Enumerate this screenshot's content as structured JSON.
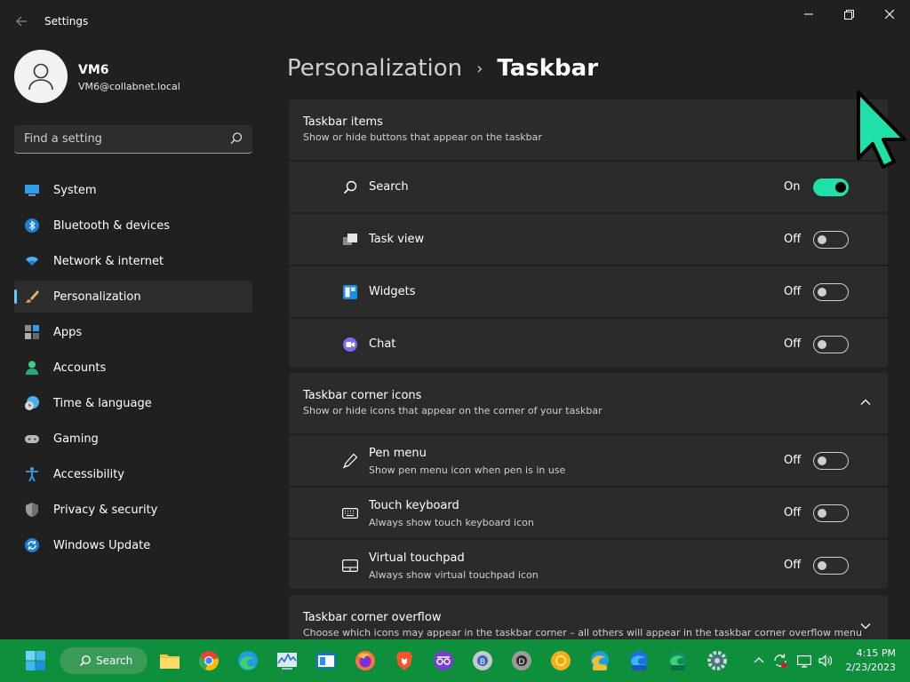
{
  "window": {
    "title": "Settings",
    "controls": {
      "minimize": "minimize-icon",
      "maximize": "restore-icon",
      "close": "close-icon"
    }
  },
  "profile": {
    "name": "VM6",
    "email": "VM6@collabnet.local"
  },
  "search": {
    "placeholder": "Find a setting"
  },
  "sidebar": {
    "items": [
      {
        "label": "System",
        "icon": "system-icon",
        "selected": false
      },
      {
        "label": "Bluetooth & devices",
        "icon": "bluetooth-icon",
        "selected": false
      },
      {
        "label": "Network & internet",
        "icon": "wifi-icon",
        "selected": false
      },
      {
        "label": "Personalization",
        "icon": "brush-icon",
        "selected": true
      },
      {
        "label": "Apps",
        "icon": "apps-icon",
        "selected": false
      },
      {
        "label": "Accounts",
        "icon": "person-icon",
        "selected": false
      },
      {
        "label": "Time & language",
        "icon": "clock-globe-icon",
        "selected": false
      },
      {
        "label": "Gaming",
        "icon": "gamepad-icon",
        "selected": false
      },
      {
        "label": "Accessibility",
        "icon": "accessibility-icon",
        "selected": false
      },
      {
        "label": "Privacy & security",
        "icon": "shield-icon",
        "selected": false
      },
      {
        "label": "Windows Update",
        "icon": "update-icon",
        "selected": false
      }
    ]
  },
  "breadcrumb": {
    "parent": "Personalization",
    "separator": "›",
    "current": "Taskbar"
  },
  "sections": {
    "items": {
      "title": "Taskbar items",
      "subtitle": "Show or hide buttons that appear on the taskbar",
      "rows": [
        {
          "label": "Search",
          "state": "On",
          "on": true
        },
        {
          "label": "Task view",
          "state": "Off",
          "on": false
        },
        {
          "label": "Widgets",
          "state": "Off",
          "on": false
        },
        {
          "label": "Chat",
          "state": "Off",
          "on": false
        }
      ]
    },
    "corner": {
      "title": "Taskbar corner icons",
      "subtitle": "Show or hide icons that appear on the corner of your taskbar",
      "rows": [
        {
          "label": "Pen menu",
          "sub": "Show pen menu icon when pen is in use",
          "state": "Off",
          "on": false
        },
        {
          "label": "Touch keyboard",
          "sub": "Always show touch keyboard icon",
          "state": "Off",
          "on": false
        },
        {
          "label": "Virtual touchpad",
          "sub": "Always show virtual touchpad icon",
          "state": "Off",
          "on": false
        }
      ]
    },
    "overflow": {
      "title": "Taskbar corner overflow",
      "subtitle": "Choose which icons may appear in the taskbar corner – all others will appear in the taskbar corner overflow menu"
    }
  },
  "taskbar": {
    "search_label": "Search",
    "apps": [
      "file-explorer-icon",
      "chrome-icon",
      "edge-icon",
      "performance-monitor-icon",
      "app-window-icon",
      "firefox-icon",
      "brave-icon",
      "incognito-icon",
      "chrome-beta-icon",
      "chrome-dev-icon",
      "chrome-canary-icon",
      "edge-canary-icon",
      "edge-beta-icon",
      "edge-dev-icon",
      "settings-icon"
    ],
    "time": "4:15 PM",
    "date": "2/23/2023"
  },
  "colors": {
    "accent": "#60cdff",
    "toggle_on": "#1ee0a8",
    "taskbar": "#0e8f3c",
    "cursor": "#1ee0a8"
  }
}
